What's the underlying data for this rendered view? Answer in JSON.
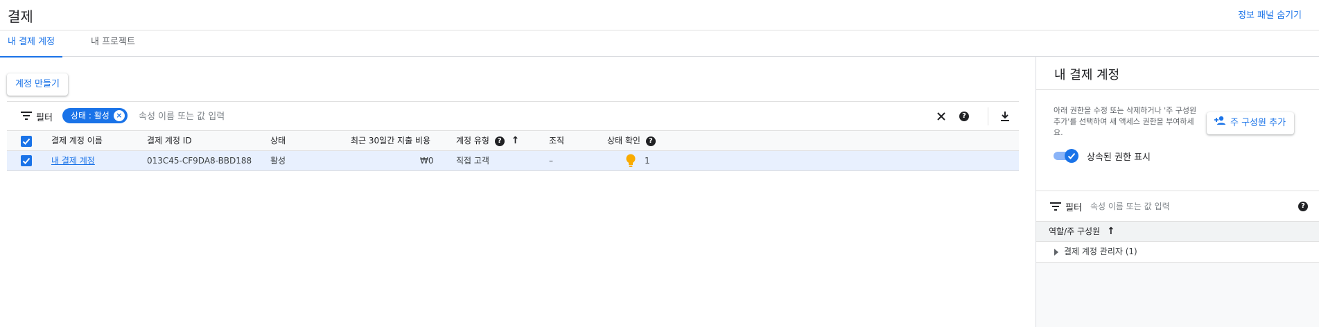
{
  "header": {
    "title": "결제",
    "hide_panel_label": "정보 패널 숨기기"
  },
  "tabs": [
    {
      "label": "내 결제 계정",
      "active": true
    },
    {
      "label": "내 프로젝트",
      "active": false
    }
  ],
  "toolbar": {
    "create_label": "계정 만들기"
  },
  "filter": {
    "label": "필터",
    "chip_label": "상태 : 활성",
    "placeholder": "속성 이름 또는 값 입력"
  },
  "table": {
    "columns": {
      "name": "결제 계정 이름",
      "id": "결제 계정 ID",
      "status": "상태",
      "cost": "최근 30일간 지출 비용",
      "type": "계정 유형",
      "org": "조직",
      "check": "상태 확인"
    },
    "rows": [
      {
        "name": "내 결제 계정",
        "id": "013C45-CF9DA8-BBD188",
        "status": "활성",
        "cost": "₩0",
        "type": "직접 고객",
        "org": "–",
        "check_count": "1"
      }
    ]
  },
  "panel": {
    "title": "내 결제 계정",
    "description": "아래 권한을 수정 또는 삭제하거나 '주 구성원 추가'를 선택하여 새 액세스 권한을 부여하세요.",
    "add_label": "주 구성원 추가",
    "toggle_label": "상속된 권한 표시",
    "toggle_on": true,
    "filter_label": "필터",
    "filter_placeholder": "속성 이름 또는 값 입력",
    "column_header": "역할/주 구성원",
    "rows": [
      {
        "label": "결제 계정 관리자 (1)"
      }
    ]
  },
  "colors": {
    "accent": "#1a73e8",
    "selected_row": "#e8f0fe",
    "bulb": "#f9ab00"
  }
}
